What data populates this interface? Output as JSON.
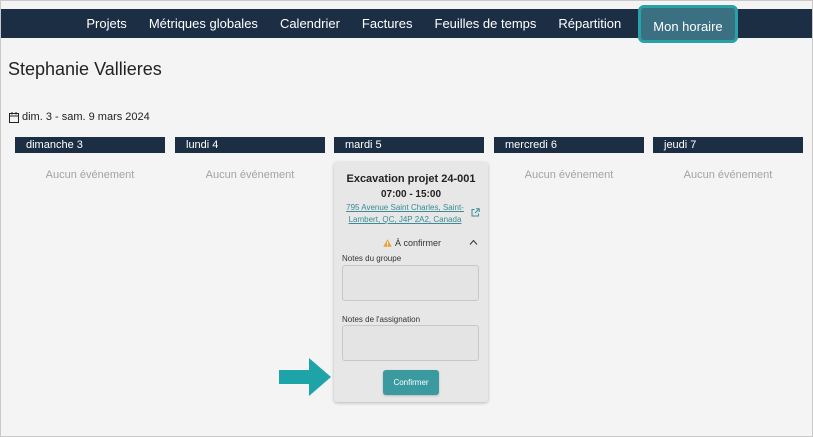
{
  "nav": {
    "items": [
      "Projets",
      "Métriques globales",
      "Calendrier",
      "Factures",
      "Feuilles de temps",
      "Répartition"
    ],
    "active": "Mon horaire"
  },
  "user": {
    "name": "Stephanie Vallieres"
  },
  "week": {
    "range": "dim. 3 - sam. 9 mars 2024",
    "days": [
      {
        "label": "dimanche 3",
        "empty": "Aucun événement"
      },
      {
        "label": "lundi 4",
        "empty": "Aucun événement"
      },
      {
        "label": "mardi 5",
        "empty": ""
      },
      {
        "label": "mercredi 6",
        "empty": "Aucun événement"
      },
      {
        "label": "jeudi 7",
        "empty": "Aucun événement"
      }
    ]
  },
  "event": {
    "title": "Excavation projet 24-001",
    "time": "07:00 - 15:00",
    "address": "795 Avenue Saint Charles, Saint-Lambert, QC, J4P 2A2, Canada",
    "status": "À confirmer",
    "group_notes_label": "Notes du groupe",
    "assignment_notes_label": "Notes de l'assignation",
    "confirm_label": "Confirmer"
  },
  "colors": {
    "navbar": "#1c2e44",
    "accent": "#3a9aa0",
    "active_border": "#27a2a8",
    "warning": "#e8a33a"
  }
}
